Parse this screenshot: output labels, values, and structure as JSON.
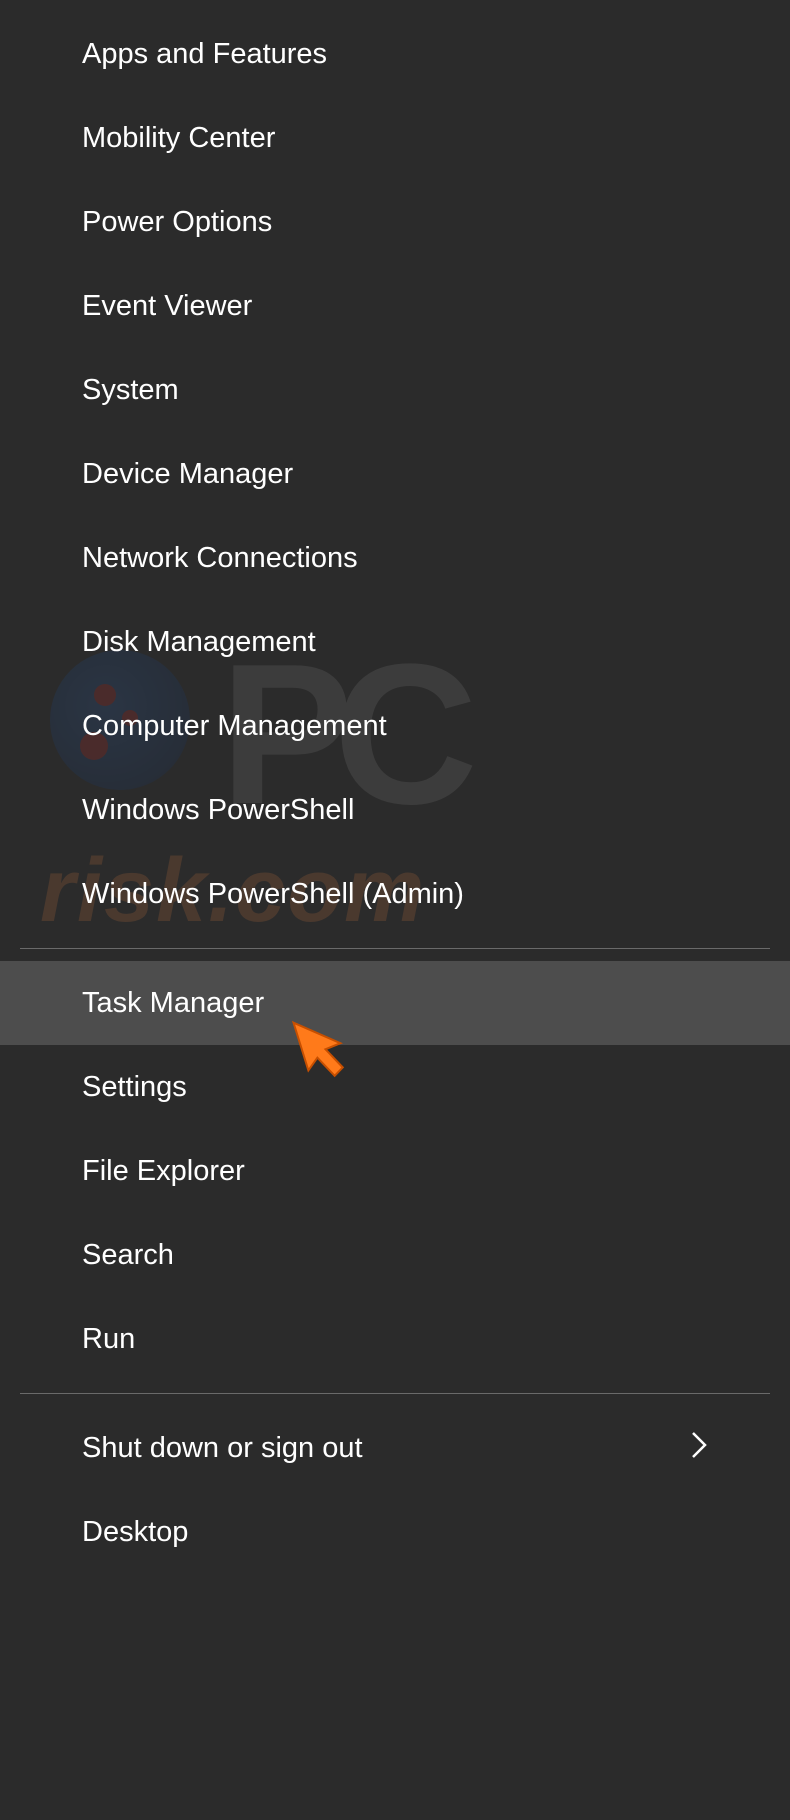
{
  "watermark": {
    "text": "risk.com",
    "letters": "PC"
  },
  "menu": {
    "group1": [
      "Apps and Features",
      "Mobility Center",
      "Power Options",
      "Event Viewer",
      "System",
      "Device Manager",
      "Network Connections",
      "Disk Management",
      "Computer Management",
      "Windows PowerShell",
      "Windows PowerShell (Admin)"
    ],
    "group2": [
      "Task Manager",
      "Settings",
      "File Explorer",
      "Search",
      "Run"
    ],
    "group3": [
      "Shut down or sign out",
      "Desktop"
    ],
    "hovered_item": "Task Manager",
    "submenu_item": "Shut down or sign out"
  }
}
